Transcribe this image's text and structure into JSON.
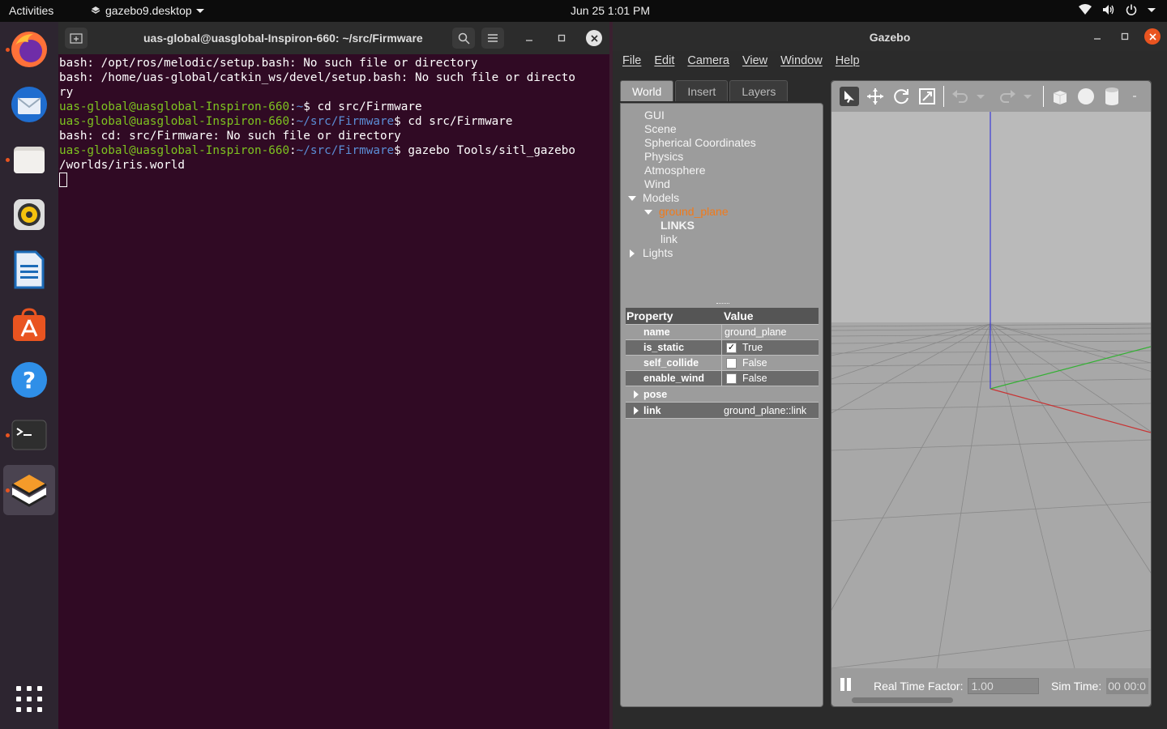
{
  "topbar": {
    "activities": "Activities",
    "app_name": "gazebo9.desktop",
    "clock": "Jun 25  1:01 PM"
  },
  "dock": {
    "items": [
      "Firefox",
      "Thunderbird",
      "Files",
      "Rhythmbox",
      "LibreOffice Writer",
      "Ubuntu Software",
      "Help",
      "Terminal",
      "Gazebo"
    ]
  },
  "terminal": {
    "title": "uas-global@uasglobal-Inspiron-660: ~/src/Firmware",
    "lines": {
      "l1": "bash: /opt/ros/melodic/setup.bash: No such file or directory",
      "l2": "bash: /home/uas-global/catkin_ws/devel/setup.bash: No such file or directo",
      "l3": "ry",
      "p1_user": "uas-global@uasglobal-Inspiron-660",
      "p1_path": "~",
      "p1_cmd": "$ cd src/Firmware",
      "p2_user": "uas-global@uasglobal-Inspiron-660",
      "p2_path": "~/src/Firmware",
      "p2_cmd": "$ cd src/Firmware",
      "l6": "bash: cd: src/Firmware: No such file or directory",
      "p3_user": "uas-global@uasglobal-Inspiron-660",
      "p3_path": "~/src/Firmware",
      "p3_cmd": "$ gazebo Tools/sitl_gazebo",
      "l8": "/worlds/iris.world"
    }
  },
  "gazebo": {
    "title": "Gazebo",
    "menu": {
      "file": "File",
      "edit": "Edit",
      "camera": "Camera",
      "view": "View",
      "window": "Window",
      "help": "Help"
    },
    "tabs": {
      "world": "World",
      "insert": "Insert",
      "layers": "Layers"
    },
    "tree": {
      "gui": "GUI",
      "scene": "Scene",
      "spherical": "Spherical Coordinates",
      "physics": "Physics",
      "atmosphere": "Atmosphere",
      "wind": "Wind",
      "models": "Models",
      "ground_plane": "ground_plane",
      "links": "LINKS",
      "link": "link",
      "lights": "Lights"
    },
    "props": {
      "h_property": "Property",
      "h_value": "Value",
      "name_k": "name",
      "name_v": "ground_plane",
      "static_k": "is_static",
      "static_v": "True",
      "collide_k": "self_collide",
      "collide_v": "False",
      "wind_k": "enable_wind",
      "wind_v": "False",
      "pose_k": "pose",
      "link_k": "link",
      "link_v": "ground_plane::link"
    },
    "bottom": {
      "rtf_label": "Real Time Factor:",
      "rtf_value": "1.00",
      "sim_label": "Sim Time:",
      "sim_value": "00 00:0"
    }
  },
  "colors": {
    "terminal_bg": "#300a24",
    "prompt_user": "#7ec320",
    "prompt_path": "#5b8ed6",
    "selected_model": "#f07a1b",
    "ubuntu_orange": "#e95420"
  }
}
